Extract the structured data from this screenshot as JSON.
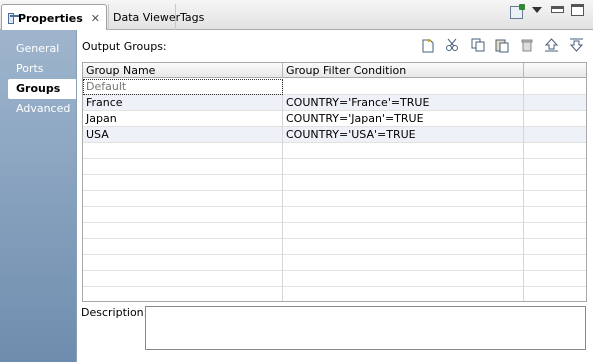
{
  "tabs": [
    {
      "label": "Properties",
      "active": true
    },
    {
      "label": "Data Viewer",
      "active": false
    },
    {
      "label": "Tags",
      "active": false
    }
  ],
  "sidebar": {
    "items": [
      {
        "label": "General",
        "active": false
      },
      {
        "label": "Ports",
        "active": false
      },
      {
        "label": "Groups",
        "active": true
      },
      {
        "label": "Advanced",
        "active": false
      }
    ]
  },
  "main": {
    "section_label": "Output Groups:",
    "toolbar_icons": [
      "new-icon",
      "cut-icon",
      "copy-icon",
      "paste-icon",
      "delete-icon",
      "move-up-icon",
      "move-down-icon"
    ],
    "table": {
      "columns": [
        "Group Name",
        "Group Filter Condition",
        ""
      ],
      "rows": [
        {
          "name": "Default",
          "condition": ""
        },
        {
          "name": "France",
          "condition": "COUNTRY='France'=TRUE"
        },
        {
          "name": "Japan",
          "condition": "COUNTRY='Japan'=TRUE"
        },
        {
          "name": "USA",
          "condition": "COUNTRY='USA'=TRUE"
        }
      ]
    },
    "description_label": "Description:",
    "description_value": ""
  },
  "colors": {
    "sidebar_top": "#9fb5cd",
    "sidebar_bottom": "#6e8dae",
    "row_alt": "#eef1f7"
  }
}
